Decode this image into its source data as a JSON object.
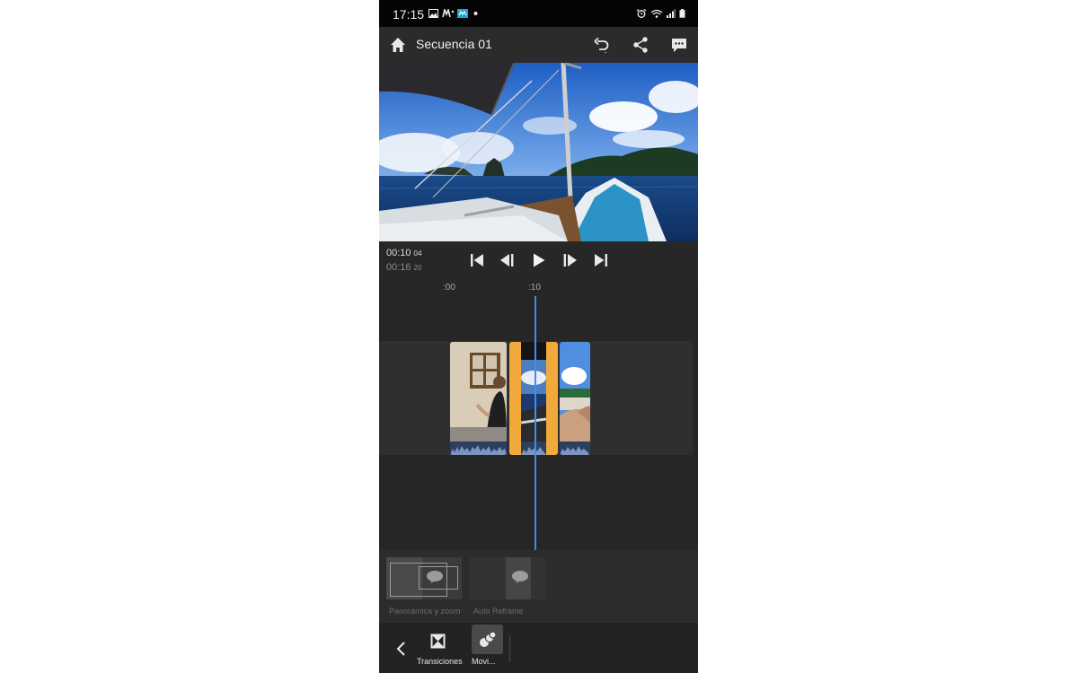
{
  "status_bar": {
    "time": "17:15",
    "left_icons": [
      "image-icon",
      "carrier-m-icon",
      "carrier-app-icon",
      "dot-icon"
    ],
    "right_icons": [
      "alarm-icon",
      "wifi-icon",
      "signal-icon",
      "battery-icon"
    ]
  },
  "app_bar": {
    "title": "Secuencia 01",
    "icons": [
      "home-icon",
      "undo-icon",
      "share-icon",
      "comment-icon"
    ]
  },
  "transport": {
    "current_time": "00:10",
    "current_frames": "04",
    "total_time": "00:16",
    "total_frames": "20",
    "buttons": [
      "skip-to-start-icon",
      "step-back-icon",
      "play-icon",
      "step-forward-icon",
      "skip-to-end-icon"
    ]
  },
  "timeline": {
    "ruler_labels": [
      ":00",
      ":10"
    ],
    "clips": [
      "clip-house-woman",
      "clip-boat-selected",
      "clip-sky-hand"
    ],
    "selected_clip": 1
  },
  "effects": {
    "items": [
      {
        "label": "Panorámica y zoom"
      },
      {
        "label": "Auto Reframe"
      }
    ]
  },
  "toolbar": {
    "back_icon": "chevron-left-icon",
    "items": [
      {
        "label": "Transiciones",
        "icon": "transitions-icon"
      },
      {
        "label": "Movi...",
        "icon": "motion-icon",
        "active": true
      }
    ]
  },
  "colors": {
    "selection": "#f2a93b",
    "playhead": "#3d8ef0",
    "background": "#232323"
  }
}
